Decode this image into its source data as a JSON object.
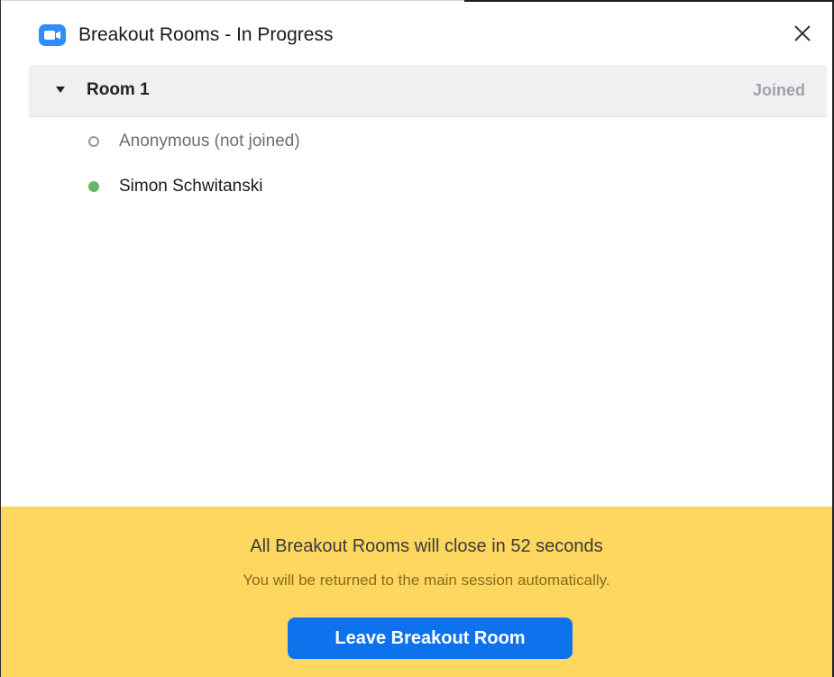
{
  "window": {
    "title": "Breakout Rooms - In Progress",
    "app_icon": "zoom-camera-icon",
    "close_icon": "close-icon"
  },
  "room": {
    "name": "Room 1",
    "status": "Joined",
    "expanded": true
  },
  "participants": [
    {
      "name": "Anonymous (not joined)",
      "joined": false
    },
    {
      "name": "Simon Schwitanski",
      "joined": true
    }
  ],
  "footer": {
    "message": "All Breakout Rooms will close in 52 seconds",
    "submessage": "You will be returned to the main session automatically.",
    "leave_button": "Leave Breakout Room"
  },
  "colors": {
    "accent_blue": "#0e72ed",
    "app_icon_blue": "#2d8cff",
    "banner_yellow": "#fdd760",
    "joined_green": "#64b966",
    "room_header_bg": "#f0f0f3"
  }
}
